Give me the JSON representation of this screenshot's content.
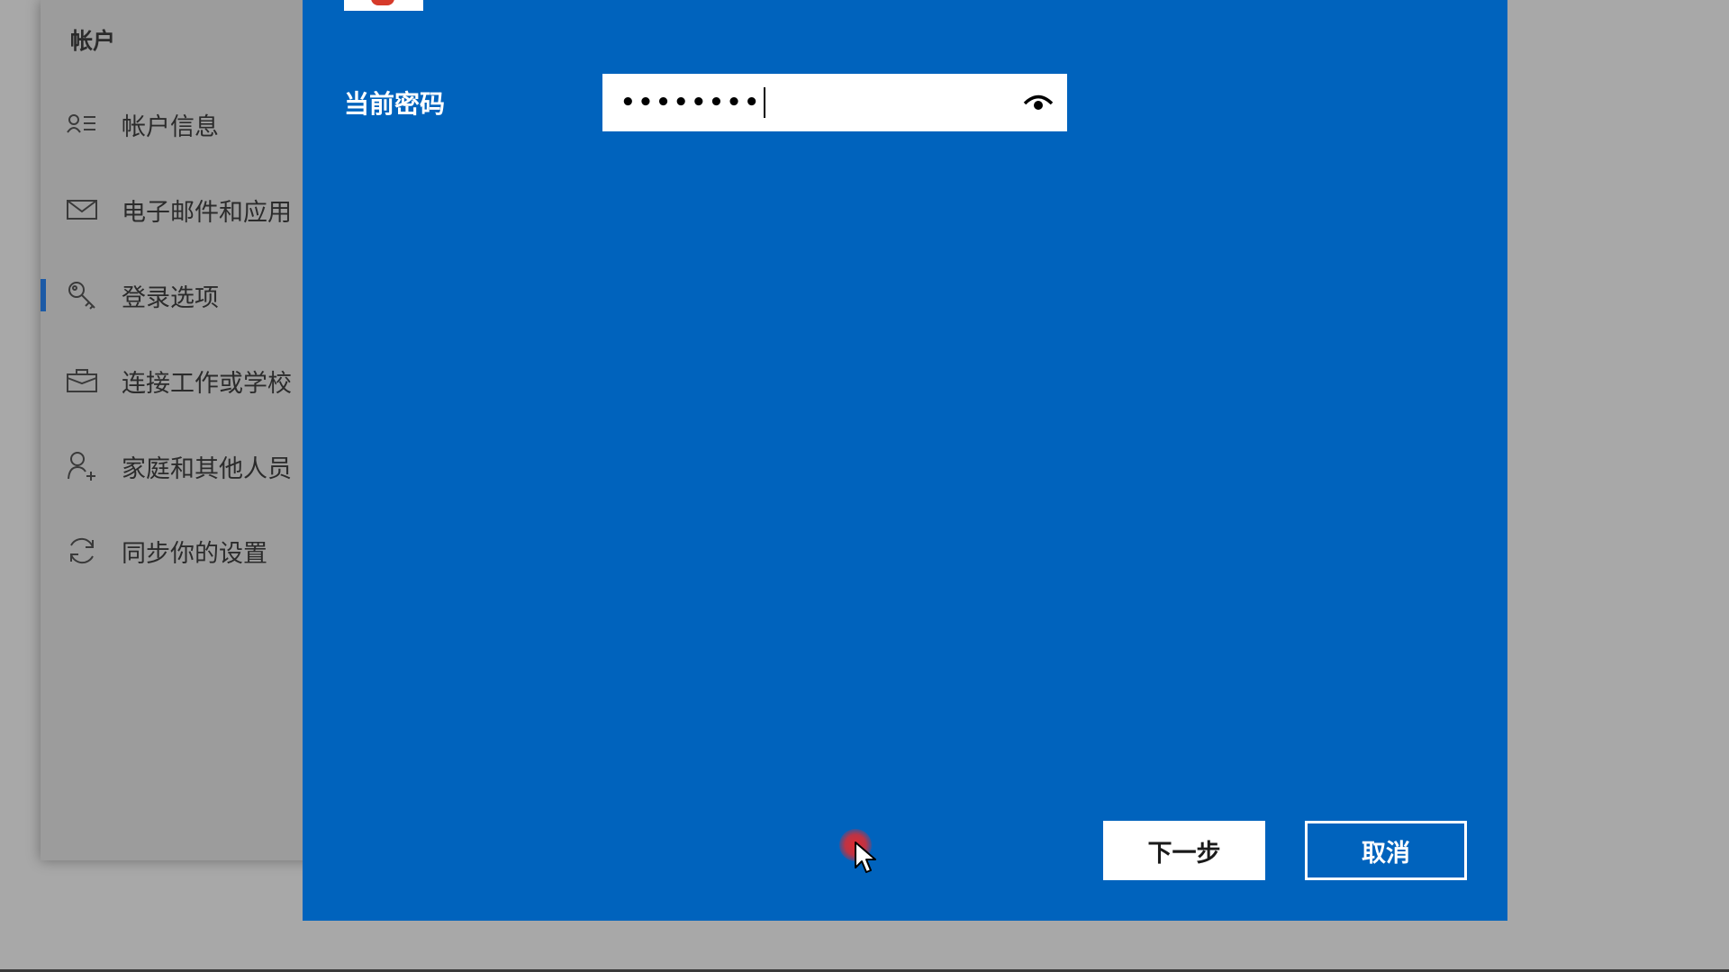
{
  "sidebar": {
    "section_title": "帐户",
    "items": [
      {
        "label": "帐户信息",
        "icon": "account-info-icon",
        "selected": false
      },
      {
        "label": "电子邮件和应用",
        "icon": "mail-icon",
        "selected": false
      },
      {
        "label": "登录选项",
        "icon": "key-icon",
        "selected": true
      },
      {
        "label": "连接工作或学校",
        "icon": "briefcase-icon",
        "selected": false
      },
      {
        "label": "家庭和其他人员",
        "icon": "add-person-icon",
        "selected": false
      },
      {
        "label": "同步你的设置",
        "icon": "sync-icon",
        "selected": false
      }
    ]
  },
  "dialog": {
    "field_label": "当前密码",
    "password_value": "••••••••",
    "reveal_icon": "eye-icon",
    "next_button": "下一步",
    "cancel_button": "取消"
  },
  "colors": {
    "dialog_background": "#0063bd",
    "accent": "#1c5aa6",
    "overlay": "#a8a8a8"
  }
}
